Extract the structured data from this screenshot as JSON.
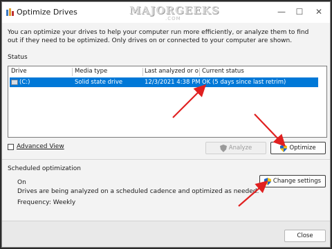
{
  "window": {
    "title": "Optimize Drives",
    "watermark": "MAJORGEEKS",
    "watermark_sub": ".COM",
    "controls": [
      "—",
      "☐",
      "✕"
    ]
  },
  "intro": "You can optimize your drives to help your computer run more efficiently, or analyze them to find out if they need to be optimized. Only drives on or connected to your computer are shown.",
  "status": {
    "label": "Status",
    "columns": [
      "Drive",
      "Media type",
      "Last analyzed or o...",
      "Current status"
    ],
    "rows": [
      {
        "drive": "(C:)",
        "media_type": "Solid state drive",
        "last_analyzed": "12/3/2021 4:38 PM",
        "current_status": "OK (5 days since last retrim)",
        "selected": true
      }
    ]
  },
  "advanced_view": {
    "label": "Advanced View",
    "checked": false
  },
  "buttons": {
    "analyze": "Analyze",
    "optimize": "Optimize",
    "change_settings": "Change settings",
    "close": "Close"
  },
  "scheduled": {
    "label": "Scheduled optimization",
    "state": "On",
    "description": "Drives are being analyzed on a scheduled cadence and optimized as needed.",
    "frequency": "Frequency: Weekly"
  },
  "colors": {
    "selection": "#0078d7",
    "annotation_arrow": "#e02020"
  }
}
